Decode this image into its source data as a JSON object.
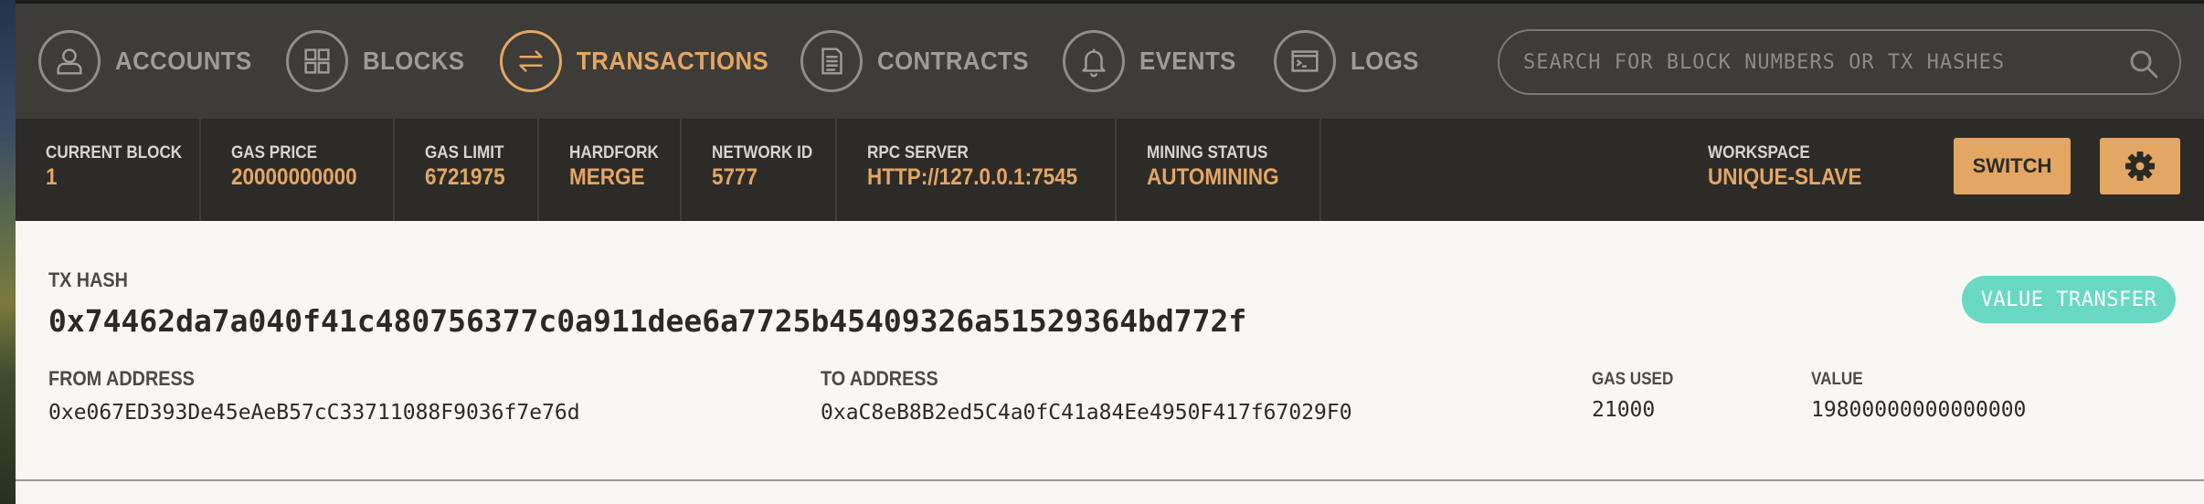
{
  "nav": {
    "items": [
      {
        "label": "ACCOUNTS",
        "icon": "user-icon",
        "active": false
      },
      {
        "label": "BLOCKS",
        "icon": "grid-icon",
        "active": false
      },
      {
        "label": "TRANSACTIONS",
        "icon": "swap-arrows-icon",
        "active": true
      },
      {
        "label": "CONTRACTS",
        "icon": "document-icon",
        "active": false
      },
      {
        "label": "EVENTS",
        "icon": "bell-icon",
        "active": false
      },
      {
        "label": "LOGS",
        "icon": "terminal-icon",
        "active": false
      }
    ],
    "search_placeholder": "SEARCH FOR BLOCK NUMBERS OR TX HASHES"
  },
  "status": {
    "current_block_label": "CURRENT BLOCK",
    "current_block": "1",
    "gas_price_label": "GAS PRICE",
    "gas_price": "20000000000",
    "gas_limit_label": "GAS LIMIT",
    "gas_limit": "6721975",
    "hardfork_label": "HARDFORK",
    "hardfork": "MERGE",
    "network_id_label": "NETWORK ID",
    "network_id": "5777",
    "rpc_server_label": "RPC SERVER",
    "rpc_server": "HTTP://127.0.0.1:7545",
    "mining_status_label": "MINING STATUS",
    "mining_status": "AUTOMINING",
    "workspace_label": "WORKSPACE",
    "workspace": "UNIQUE-SLAVE",
    "switch_label": "SWITCH"
  },
  "tx": {
    "hash_label": "TX HASH",
    "hash": "0x74462da7a040f41c480756377c0a911dee6a7725b45409326a51529364bd772f",
    "type_badge": "VALUE TRANSFER",
    "from_label": "FROM ADDRESS",
    "from": "0xe067ED393De45eAeB57cC33711088F9036f7e76d",
    "to_label": "TO ADDRESS",
    "to": "0xaC8eB8B2ed5C4a0fC41a84Ee4950F417f67029F0",
    "gas_used_label": "GAS USED",
    "gas_used": "21000",
    "value_label": "VALUE",
    "value": "19800000000000000"
  },
  "colors": {
    "accent": "#e4a663",
    "topbar": "#3d3c38",
    "statusbar": "#2c2b28",
    "badge": "#69d9c4",
    "content_bg": "#f8f7f3"
  }
}
